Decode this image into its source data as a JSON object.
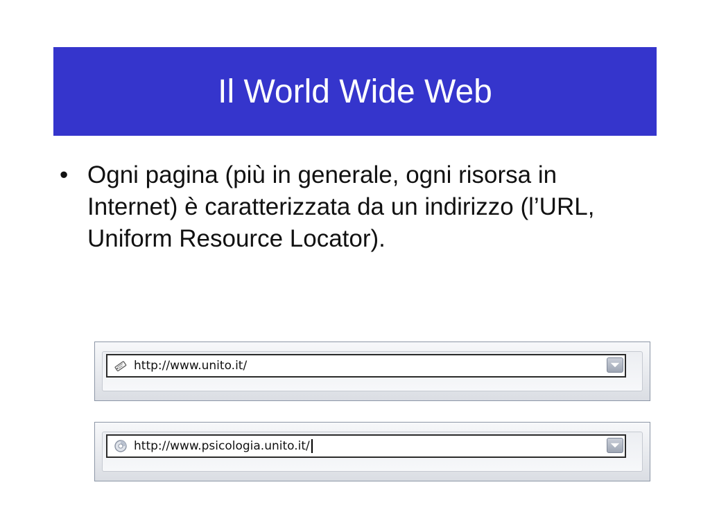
{
  "slide": {
    "title": "Il World Wide Web",
    "title_band_color": "#3535cc",
    "bullets": [
      {
        "marker": "•",
        "text": "Ogni pagina (più in generale, ogni risorsa in Internet) è caratterizzata da un indirizzo (l’URL, Uniform Resource Locator)."
      }
    ]
  },
  "address_bars": [
    {
      "url": "http://www.unito.it/",
      "icon": "page-bookmark-icon",
      "has_caret": false
    },
    {
      "url": "http://www.psicologia.unito.it/",
      "icon": "loading-globe-icon",
      "has_caret": true
    }
  ],
  "dropdown_icon": "chevron-down-icon"
}
